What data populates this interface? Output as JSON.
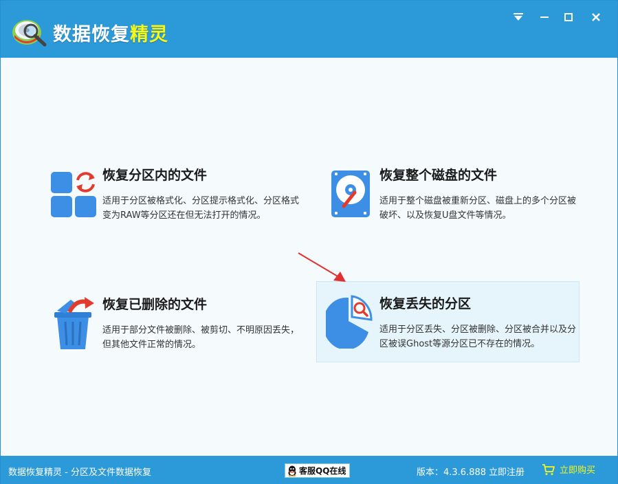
{
  "app": {
    "title_main": "数据恢复",
    "title_accent": "精灵"
  },
  "window_controls": {
    "menu_icon": "menu-icon",
    "minimize_icon": "minimize-icon",
    "maximize_icon": "maximize-icon",
    "close_icon": "close-icon"
  },
  "cards": [
    {
      "title": "恢复分区内的文件",
      "desc": "适用于分区被格式化、分区提示格式化、分区格式变为RAW等分区还在但无法打开的情况。",
      "icon": "partition-files-icon"
    },
    {
      "title": "恢复整个磁盘的文件",
      "desc": "适用于整个磁盘被重新分区、磁盘上的多个分区被破坏、以及恢复U盘文件等情况。",
      "icon": "hard-disk-icon"
    },
    {
      "title": "恢复已删除的文件",
      "desc": "适用于部分文件被删除、被剪切、不明原因丢失，但其他文件正常的情况。",
      "icon": "recycle-bin-icon"
    },
    {
      "title": "恢复丢失的分区",
      "desc": "适用于分区丢失、分区被删除、分区被合并以及分区被误Ghost等源分区已不存在的情况。",
      "icon": "lost-partition-icon"
    }
  ],
  "statusbar": {
    "left_text": "数据恢复精灵 - 分区及文件数据恢复",
    "qq_label": "客服QQ在线",
    "version_text": "版本：4.3.6.888",
    "register_label": "立即注册",
    "buy_label": "立即购买"
  },
  "colors": {
    "titlebar": "#2c9ad8",
    "accent_yellow": "#f3f71b",
    "selected_card": "#e6f5fc",
    "arrow_red": "#e03030"
  }
}
